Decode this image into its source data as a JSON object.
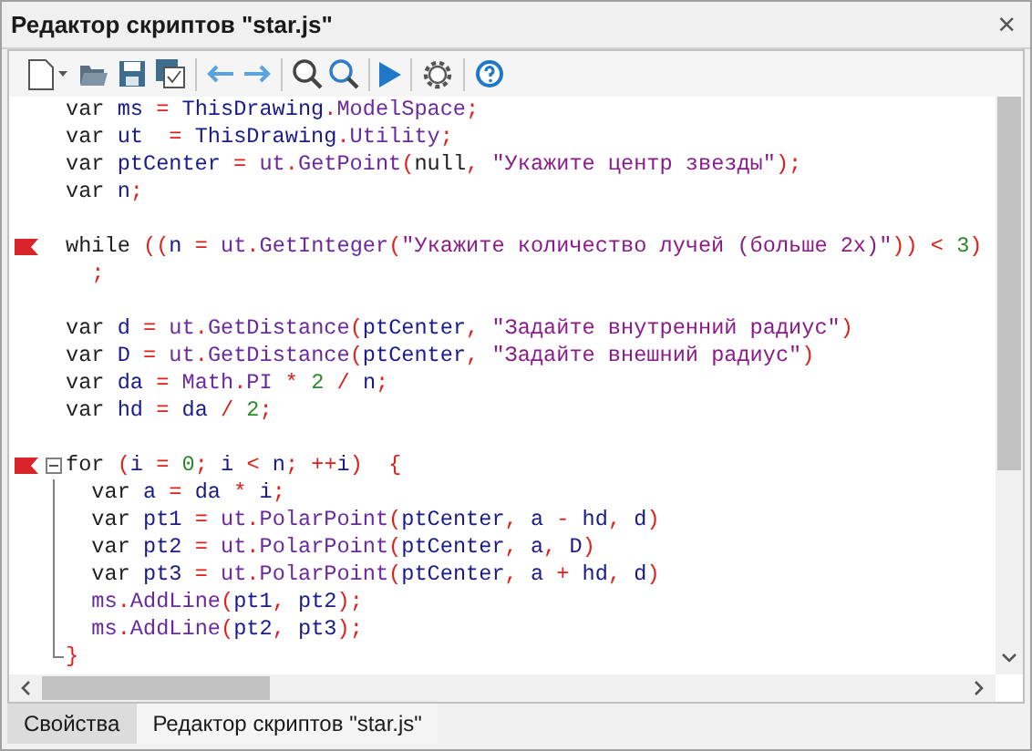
{
  "window": {
    "title": "Редактор скриптов \"star.js\"",
    "close": "×"
  },
  "editor": {
    "lines": [
      {
        "kind": "code",
        "flag": false,
        "tokens": [
          {
            "color": "#1e1e1e",
            "t": "var "
          },
          {
            "color": "#1a1a8c",
            "t": "ms "
          },
          {
            "color": "#e0201b",
            "t": "= "
          },
          {
            "color": "#1a1a8c",
            "t": "ThisDrawing"
          },
          {
            "color": "#e0201b",
            "t": "."
          },
          {
            "color": "#6a2a9e",
            "t": "ModelSpace"
          },
          {
            "color": "#e0201b",
            "t": ";"
          }
        ]
      },
      {
        "kind": "code",
        "flag": false,
        "tokens": [
          {
            "color": "#1e1e1e",
            "t": "var "
          },
          {
            "color": "#1a1a8c",
            "t": "ut  "
          },
          {
            "color": "#e0201b",
            "t": "= "
          },
          {
            "color": "#1a1a8c",
            "t": "ThisDrawing"
          },
          {
            "color": "#e0201b",
            "t": "."
          },
          {
            "color": "#6a2a9e",
            "t": "Utility"
          },
          {
            "color": "#e0201b",
            "t": ";"
          }
        ]
      },
      {
        "kind": "code",
        "flag": false,
        "tokens": [
          {
            "color": "#1e1e1e",
            "t": "var "
          },
          {
            "color": "#1a1a8c",
            "t": "ptCenter "
          },
          {
            "color": "#e0201b",
            "t": "= "
          },
          {
            "color": "#6a2a9e",
            "t": "ut"
          },
          {
            "color": "#e0201b",
            "t": "."
          },
          {
            "color": "#6a2a9e",
            "t": "GetPoint"
          },
          {
            "color": "#e0201b",
            "t": "("
          },
          {
            "color": "#1e1e1e",
            "t": "null"
          },
          {
            "color": "#e0201b",
            "t": ", "
          },
          {
            "color": "#8a1c8a",
            "t": "\"Укажите центр звезды\""
          },
          {
            "color": "#e0201b",
            "t": ");"
          }
        ]
      },
      {
        "kind": "code",
        "flag": false,
        "tokens": [
          {
            "color": "#1e1e1e",
            "t": "var "
          },
          {
            "color": "#1a1a8c",
            "t": "n"
          },
          {
            "color": "#e0201b",
            "t": ";"
          }
        ]
      },
      {
        "kind": "blank"
      },
      {
        "kind": "code",
        "flag": true,
        "tokens": [
          {
            "color": "#1e1e1e",
            "t": "while "
          },
          {
            "color": "#e0201b",
            "t": "(("
          },
          {
            "color": "#1a1a8c",
            "t": "n "
          },
          {
            "color": "#e0201b",
            "t": "= "
          },
          {
            "color": "#6a2a9e",
            "t": "ut"
          },
          {
            "color": "#e0201b",
            "t": "."
          },
          {
            "color": "#6a2a9e",
            "t": "GetInteger"
          },
          {
            "color": "#e0201b",
            "t": "("
          },
          {
            "color": "#8a1c8a",
            "t": "\"Укажите количество лучей (больше 2х)\""
          },
          {
            "color": "#e0201b",
            "t": ")) < "
          },
          {
            "color": "#2a8a2a",
            "t": "3"
          },
          {
            "color": "#e0201b",
            "t": ")"
          }
        ]
      },
      {
        "kind": "code",
        "flag": false,
        "tokens": [
          {
            "color": "#e0201b",
            "t": "  ;"
          }
        ]
      },
      {
        "kind": "blank"
      },
      {
        "kind": "code",
        "flag": false,
        "tokens": [
          {
            "color": "#1e1e1e",
            "t": "var "
          },
          {
            "color": "#1a1a8c",
            "t": "d "
          },
          {
            "color": "#e0201b",
            "t": "= "
          },
          {
            "color": "#6a2a9e",
            "t": "ut"
          },
          {
            "color": "#e0201b",
            "t": "."
          },
          {
            "color": "#6a2a9e",
            "t": "GetDistance"
          },
          {
            "color": "#e0201b",
            "t": "("
          },
          {
            "color": "#1a1a8c",
            "t": "ptCenter"
          },
          {
            "color": "#e0201b",
            "t": ", "
          },
          {
            "color": "#8a1c8a",
            "t": "\"Задайте внутренний радиус\""
          },
          {
            "color": "#e0201b",
            "t": ")"
          }
        ]
      },
      {
        "kind": "code",
        "flag": false,
        "tokens": [
          {
            "color": "#1e1e1e",
            "t": "var "
          },
          {
            "color": "#1a1a8c",
            "t": "D "
          },
          {
            "color": "#e0201b",
            "t": "= "
          },
          {
            "color": "#6a2a9e",
            "t": "ut"
          },
          {
            "color": "#e0201b",
            "t": "."
          },
          {
            "color": "#6a2a9e",
            "t": "GetDistance"
          },
          {
            "color": "#e0201b",
            "t": "("
          },
          {
            "color": "#1a1a8c",
            "t": "ptCenter"
          },
          {
            "color": "#e0201b",
            "t": ", "
          },
          {
            "color": "#8a1c8a",
            "t": "\"Задайте внешний радиус\""
          },
          {
            "color": "#e0201b",
            "t": ")"
          }
        ]
      },
      {
        "kind": "code",
        "flag": false,
        "tokens": [
          {
            "color": "#1e1e1e",
            "t": "var "
          },
          {
            "color": "#1a1a8c",
            "t": "da "
          },
          {
            "color": "#e0201b",
            "t": "= "
          },
          {
            "color": "#6a2a9e",
            "t": "Math"
          },
          {
            "color": "#e0201b",
            "t": "."
          },
          {
            "color": "#6a2a9e",
            "t": "PI "
          },
          {
            "color": "#e0201b",
            "t": "* "
          },
          {
            "color": "#2a8a2a",
            "t": "2 "
          },
          {
            "color": "#e0201b",
            "t": "/ "
          },
          {
            "color": "#1a1a8c",
            "t": "n"
          },
          {
            "color": "#e0201b",
            "t": ";"
          }
        ]
      },
      {
        "kind": "code",
        "flag": false,
        "tokens": [
          {
            "color": "#1e1e1e",
            "t": "var "
          },
          {
            "color": "#1a1a8c",
            "t": "hd "
          },
          {
            "color": "#e0201b",
            "t": "= "
          },
          {
            "color": "#1a1a8c",
            "t": "da "
          },
          {
            "color": "#e0201b",
            "t": "/ "
          },
          {
            "color": "#2a8a2a",
            "t": "2"
          },
          {
            "color": "#e0201b",
            "t": ";"
          }
        ]
      },
      {
        "kind": "blank"
      },
      {
        "kind": "code",
        "flag": true,
        "expanded": true,
        "tokens": [
          {
            "color": "#1e1e1e",
            "t": "for "
          },
          {
            "color": "#e0201b",
            "t": "("
          },
          {
            "color": "#1a1a8c",
            "t": "i "
          },
          {
            "color": "#e0201b",
            "t": "= "
          },
          {
            "color": "#2a8a2a",
            "t": "0"
          },
          {
            "color": "#e0201b",
            "t": "; "
          },
          {
            "color": "#1a1a8c",
            "t": "i "
          },
          {
            "color": "#e0201b",
            "t": "< "
          },
          {
            "color": "#1a1a8c",
            "t": "n"
          },
          {
            "color": "#e0201b",
            "t": "; ++"
          },
          {
            "color": "#1a1a8c",
            "t": "i"
          },
          {
            "color": "#e0201b",
            "t": ")  {"
          }
        ],
        "children": [
          {
            "kind": "code",
            "flag": false,
            "tokens": [
              {
                "color": "#1e1e1e",
                "t": "  var "
              },
              {
                "color": "#1a1a8c",
                "t": "a "
              },
              {
                "color": "#e0201b",
                "t": "= "
              },
              {
                "color": "#1a1a8c",
                "t": "da "
              },
              {
                "color": "#e0201b",
                "t": "* "
              },
              {
                "color": "#1a1a8c",
                "t": "i"
              },
              {
                "color": "#e0201b",
                "t": ";"
              }
            ]
          },
          {
            "kind": "code",
            "flag": false,
            "tokens": [
              {
                "color": "#1e1e1e",
                "t": "  var "
              },
              {
                "color": "#1a1a8c",
                "t": "pt1 "
              },
              {
                "color": "#e0201b",
                "t": "= "
              },
              {
                "color": "#6a2a9e",
                "t": "ut"
              },
              {
                "color": "#e0201b",
                "t": "."
              },
              {
                "color": "#6a2a9e",
                "t": "PolarPoint"
              },
              {
                "color": "#e0201b",
                "t": "("
              },
              {
                "color": "#1a1a8c",
                "t": "ptCenter"
              },
              {
                "color": "#e0201b",
                "t": ", "
              },
              {
                "color": "#1a1a8c",
                "t": "a "
              },
              {
                "color": "#e0201b",
                "t": "- "
              },
              {
                "color": "#1a1a8c",
                "t": "hd"
              },
              {
                "color": "#e0201b",
                "t": ", "
              },
              {
                "color": "#1a1a8c",
                "t": "d"
              },
              {
                "color": "#e0201b",
                "t": ")"
              }
            ]
          },
          {
            "kind": "code",
            "flag": false,
            "tokens": [
              {
                "color": "#1e1e1e",
                "t": "  var "
              },
              {
                "color": "#1a1a8c",
                "t": "pt2 "
              },
              {
                "color": "#e0201b",
                "t": "= "
              },
              {
                "color": "#6a2a9e",
                "t": "ut"
              },
              {
                "color": "#e0201b",
                "t": "."
              },
              {
                "color": "#6a2a9e",
                "t": "PolarPoint"
              },
              {
                "color": "#e0201b",
                "t": "("
              },
              {
                "color": "#1a1a8c",
                "t": "ptCenter"
              },
              {
                "color": "#e0201b",
                "t": ", "
              },
              {
                "color": "#1a1a8c",
                "t": "a"
              },
              {
                "color": "#e0201b",
                "t": ", "
              },
              {
                "color": "#1a1a8c",
                "t": "D"
              },
              {
                "color": "#e0201b",
                "t": ")"
              }
            ]
          },
          {
            "kind": "code",
            "flag": false,
            "tokens": [
              {
                "color": "#1e1e1e",
                "t": "  var "
              },
              {
                "color": "#1a1a8c",
                "t": "pt3 "
              },
              {
                "color": "#e0201b",
                "t": "= "
              },
              {
                "color": "#6a2a9e",
                "t": "ut"
              },
              {
                "color": "#e0201b",
                "t": "."
              },
              {
                "color": "#6a2a9e",
                "t": "PolarPoint"
              },
              {
                "color": "#e0201b",
                "t": "("
              },
              {
                "color": "#1a1a8c",
                "t": "ptCenter"
              },
              {
                "color": "#e0201b",
                "t": ", "
              },
              {
                "color": "#1a1a8c",
                "t": "a "
              },
              {
                "color": "#e0201b",
                "t": "+ "
              },
              {
                "color": "#1a1a8c",
                "t": "hd"
              },
              {
                "color": "#e0201b",
                "t": ", "
              },
              {
                "color": "#1a1a8c",
                "t": "d"
              },
              {
                "color": "#e0201b",
                "t": ")"
              }
            ]
          },
          {
            "kind": "code",
            "flag": false,
            "tokens": [
              {
                "color": "#6a2a9e",
                "t": "  ms"
              },
              {
                "color": "#e0201b",
                "t": "."
              },
              {
                "color": "#6a2a9e",
                "t": "AddLine"
              },
              {
                "color": "#e0201b",
                "t": "("
              },
              {
                "color": "#1a1a8c",
                "t": "pt1"
              },
              {
                "color": "#e0201b",
                "t": ", "
              },
              {
                "color": "#1a1a8c",
                "t": "pt2"
              },
              {
                "color": "#e0201b",
                "t": ");"
              }
            ]
          },
          {
            "kind": "code",
            "flag": false,
            "tokens": [
              {
                "color": "#6a2a9e",
                "t": "  ms"
              },
              {
                "color": "#e0201b",
                "t": "."
              },
              {
                "color": "#6a2a9e",
                "t": "AddLine"
              },
              {
                "color": "#e0201b",
                "t": "("
              },
              {
                "color": "#1a1a8c",
                "t": "pt2"
              },
              {
                "color": "#e0201b",
                "t": ", "
              },
              {
                "color": "#1a1a8c",
                "t": "pt3"
              },
              {
                "color": "#e0201b",
                "t": ");"
              }
            ]
          },
          {
            "kind": "code",
            "flag": false,
            "tokens": [
              {
                "color": "#e0201b",
                "t": "}"
              }
            ]
          }
        ]
      }
    ]
  },
  "bottom_tabs": [
    {
      "label": "Свойства",
      "selected": false
    },
    {
      "label": "Редактор скриптов \"star.js\"",
      "selected": true
    }
  ]
}
